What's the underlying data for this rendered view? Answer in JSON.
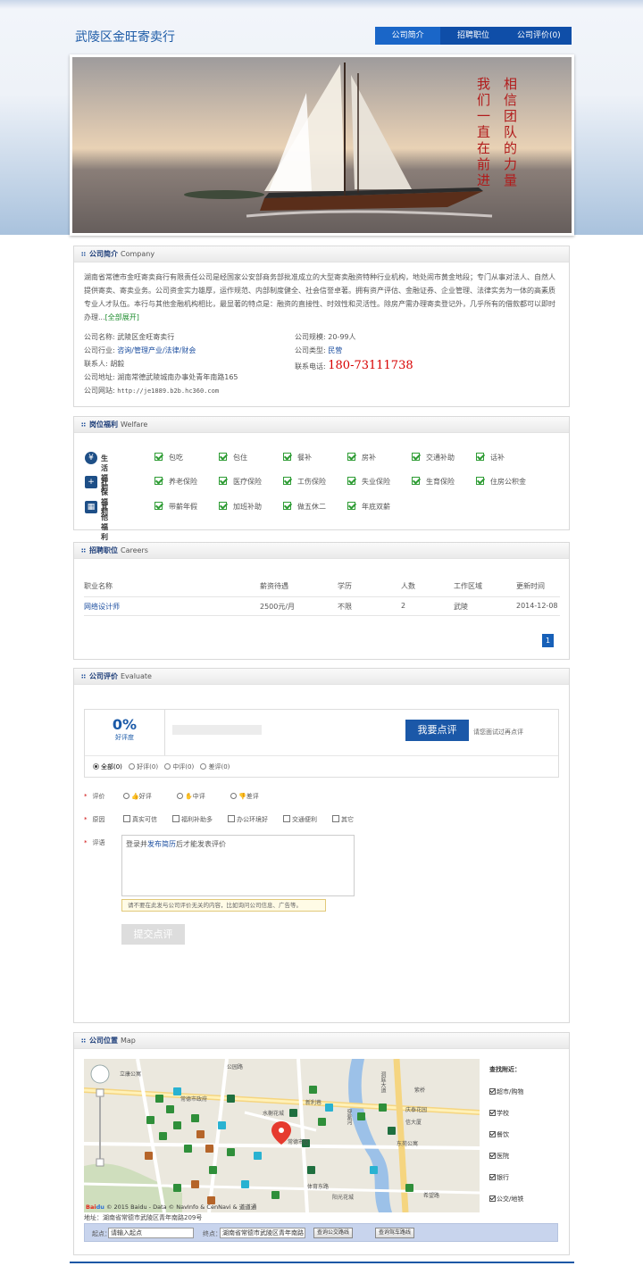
{
  "header": {
    "company_name": "武陵区金旺寄卖行",
    "nav": [
      {
        "label": "公司简介",
        "active": true
      },
      {
        "label": "招聘职位",
        "active": false
      },
      {
        "label": "公司评价(0)",
        "active": false
      }
    ]
  },
  "banner": {
    "slogan_right": "相信团队的力量",
    "slogan_left": "我们一直在前进"
  },
  "intro": {
    "title": "公司简介",
    "title_en": "Company",
    "text": "湖南省常德市金旺寄卖商行有限责任公司是经国家公安部商务部批准成立的大型寄卖融资特种行业机构，地处闹市黄金地段；专门从事对法人、自然人提供寄卖、寄卖业务。公司资金实力雄厚，运作规范、内部制度健全、社会信誉卓著。拥有资产评估、金融证券、企业管理、法律实务为一体的高素质专业人才队伍。本行与其他金融机构相比，最显著的特点是：融资的直接性、时效性和灵活性。除房产需办理寄卖登记外，几乎所有的借款都可以即时办理...",
    "more": "[全部展开]",
    "fields": {
      "name_label": "公司名称:",
      "name": "武陵区金旺寄卖行",
      "industry_label": "公司行业:",
      "industry": "咨询/管理产业/法律/财会",
      "contact_label": "联系人:",
      "contact": "胡毅",
      "address_label": "公司地址:",
      "address": "湖南常德武陵城南办事处青年南路165",
      "website_label": "公司网站:",
      "website": "http://je1889.b2b.hc360.com",
      "scale_label": "公司规模:",
      "scale": "20-99人",
      "type_label": "公司类型:",
      "type": "民营",
      "phone_label": "联系电话:",
      "phone": "180-73111738"
    }
  },
  "welfare": {
    "title": "岗位福利",
    "title_en": "Welfare",
    "rows": [
      {
        "icon": "yen-icon",
        "label": "生活福利",
        "items": [
          "包吃",
          "包住",
          "餐补",
          "房补",
          "交通补助",
          "话补"
        ]
      },
      {
        "icon": "medical-kit-icon",
        "label": "社保福利",
        "items": [
          "养老保险",
          "医疗保险",
          "工伤保险",
          "失业保险",
          "生育保险",
          "住房公积金"
        ]
      },
      {
        "icon": "calendar-icon",
        "label": "其他福利",
        "items": [
          "带薪年假",
          "加班补助",
          "做五休二",
          "年底双薪"
        ]
      }
    ]
  },
  "careers": {
    "title": "招聘职位",
    "title_en": "Careers",
    "columns": [
      "职业名称",
      "薪资待遇",
      "学历",
      "人数",
      "工作区域",
      "更新时间"
    ],
    "rows": [
      [
        "网络设计师",
        "2500元/月",
        "不限",
        "2",
        "武陵",
        "2014-12-08"
      ]
    ],
    "page": "1"
  },
  "evaluate": {
    "title": "公司评价",
    "title_en": "Evaluate",
    "rate": "0%",
    "rate_label": "好评度",
    "review_button": "我要点评",
    "review_hint": "请您面试过再点评",
    "filters": [
      "全部(0)",
      "好评(0)",
      "中评(0)",
      "差评(0)"
    ],
    "rating_label": "评价",
    "ratings": [
      "好评",
      "中评",
      "差评"
    ],
    "reason_label": "原因",
    "reasons": [
      "真实可信",
      "福利补助多",
      "办公环境好",
      "交通便利",
      "其它"
    ],
    "comment_label": "评语",
    "comment_prefix": "登录并",
    "comment_link": "发布简历",
    "comment_suffix": "后才能发表评价",
    "notice": "请不要在此发与公司评价无关的内容，比如询问公司信息、广告等。",
    "submit": "提交点评"
  },
  "map": {
    "title": "公司位置",
    "title_en": "Map",
    "nearby_title": "查找附近：",
    "nearby": [
      "超市/购物",
      "学校",
      "餐饮",
      "医院",
      "银行",
      "公交/地铁"
    ],
    "labels": [
      "常德市政府",
      "常德市区",
      "新利巷",
      "体育东路",
      "阳光花城",
      "东苑公寓",
      "希望路",
      "洞庭大道",
      "穿紫河",
      "紫桥",
      "公园路",
      "立康公寓",
      "庆泰花园",
      "水榭花城",
      "信大厦"
    ],
    "copyright": "© 2015 Baidu - Data © NavInfo & CenNavi & 道道通",
    "address": "地址：湖南省常德市武陵区青年南路209号",
    "from_label": "起点：",
    "from_value": "请输入起点",
    "to_label": "终点：",
    "to_value": "湖南省常德市武陵区青年南路",
    "bus_btn": "查询公交路线",
    "drive_btn": "查询驾车路线"
  }
}
